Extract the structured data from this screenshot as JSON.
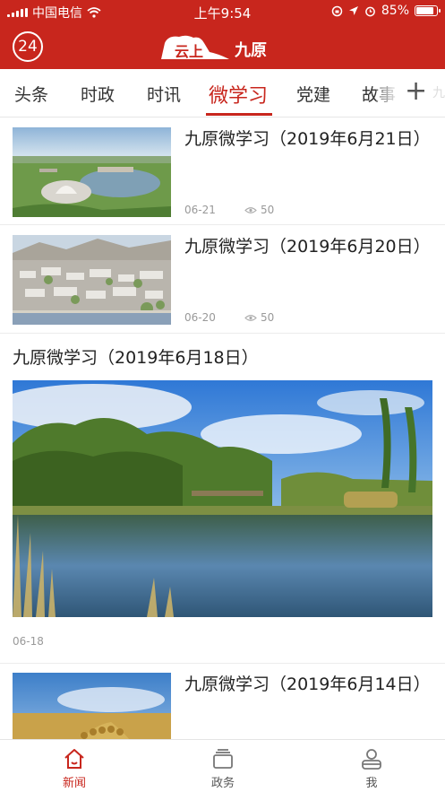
{
  "status_bar": {
    "carrier": "中国电信",
    "time": "上午9:54",
    "battery": "85%",
    "battery_level": 0.85
  },
  "header": {
    "badge": "24",
    "logo_part1": "云上",
    "logo_part2": "九原"
  },
  "tabs": {
    "items": [
      "头条",
      "时政",
      "时讯",
      "微学习",
      "党建",
      "故事"
    ],
    "active_index": 3,
    "add_symbol": "+"
  },
  "articles": [
    {
      "title": "九原微学习（2019年6月21日）",
      "date": "06-21",
      "views": "50"
    },
    {
      "title": "九原微学习（2019年6月20日）",
      "date": "06-20",
      "views": "50"
    },
    {
      "title": "九原微学习（2019年6月18日）",
      "date": "06-18"
    },
    {
      "title": "九原微学习（2019年6月14日）"
    }
  ],
  "bottom_nav": {
    "items": [
      "新闻",
      "政务",
      "我"
    ],
    "active_index": 0
  },
  "colors": {
    "brand_red": "#c8261d",
    "text_primary": "#222222",
    "text_secondary": "#999999"
  }
}
